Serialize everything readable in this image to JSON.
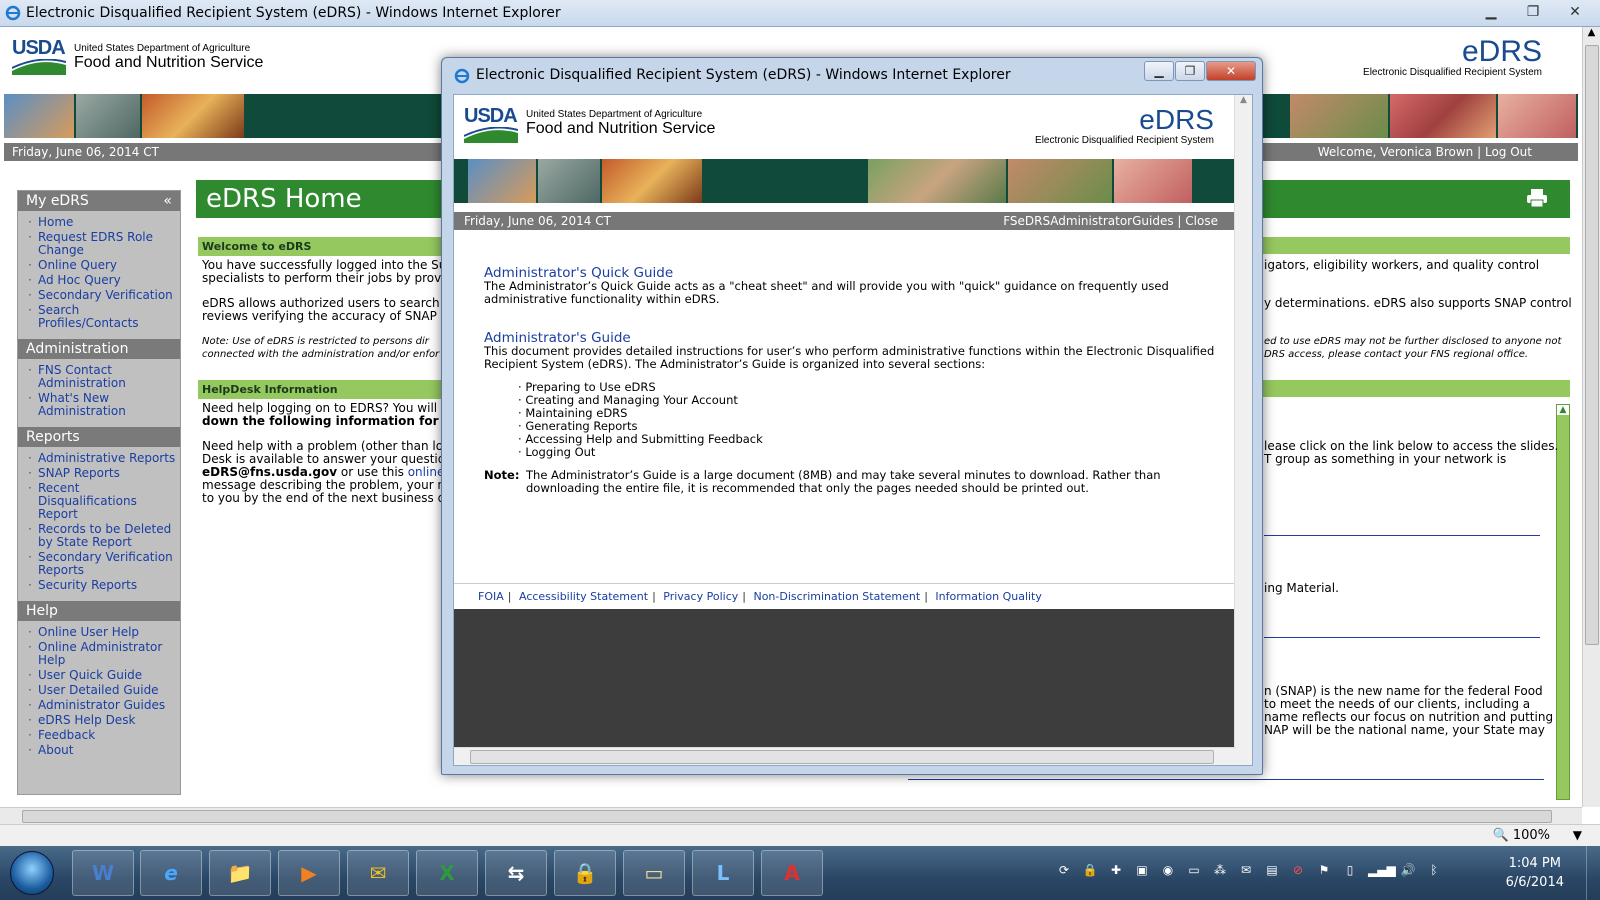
{
  "outer_window": {
    "title": "Electronic Disqualified Recipient System (eDRS) - Windows Internet Explorer",
    "controls": [
      "minimize",
      "maximize",
      "close"
    ]
  },
  "header": {
    "usda_logo": "USDA",
    "department": "United States Department of Agriculture",
    "agency": "Food and Nutrition Service",
    "edrs_logo": "eDRS",
    "edrs_full": "Electronic Disqualified Recipient System"
  },
  "date_bar": {
    "date": "Friday, June 06, 2014 CT",
    "welcome": "Welcome, Veronica Brown",
    "separator": "|",
    "logout": "Log Out"
  },
  "left_nav": {
    "sections": [
      {
        "title": "My eDRS",
        "collapse": "«",
        "items": [
          "Home",
          "Request EDRS Role Change",
          "Online Query",
          "Ad Hoc Query",
          "Secondary Verification",
          "Search Profiles/Contacts"
        ]
      },
      {
        "title": "Administration",
        "items": [
          "FNS Contact Administration",
          "What's New Administration"
        ]
      },
      {
        "title": "Reports",
        "items": [
          "Administrative Reports",
          "SNAP Reports",
          "Recent Disqualifications Report",
          "Records to be Deleted by State Report",
          "Secondary Verification Reports",
          "Security Reports"
        ]
      },
      {
        "title": "Help",
        "items": [
          "Online User Help",
          "Online Administrator Help",
          "User Quick Guide",
          "User Detailed Guide",
          "Administrator Guides",
          "eDRS Help Desk",
          "Feedback",
          "About"
        ]
      }
    ]
  },
  "main": {
    "page_title": "eDRS Home",
    "welcome_heading": "Welcome to eDRS",
    "welcome_p1_left": "You have successfully logged into the Sup",
    "welcome_p1_left2": "specialists to perform their jobs by provid",
    "welcome_p1_right": "igators, eligibility workers, and quality control",
    "welcome_p2_left": "eDRS allows authorized users to search th",
    "welcome_p2_left2": "reviews verifying the accuracy of SNAP el",
    "welcome_p2_right": "y determinations. eDRS also supports SNAP control",
    "note_left": "Note: Use of eDRS is restricted to persons dir",
    "note_left2": "connected with the administration and/or enfor",
    "note_right": "ed to use eDRS may not be further disclosed to anyone not",
    "note_right2": "DRS access, please contact your FNS regional office.",
    "helpdesk_heading": "HelpDesk Information",
    "helpdesk_p1": "Need help logging on to EDRS? You will no",
    "helpdesk_p1b": "down the following information for c",
    "helpdesk_p2": "Need help with a problem (other than logg",
    "helpdesk_p2b": "Desk is available to answer your question",
    "helpdesk_email": "eDRS@fns.usda.gov",
    "helpdesk_p2c": " or use this ",
    "helpdesk_link": "online f",
    "helpdesk_p2d": "message describing the problem, your na",
    "helpdesk_p2e": "to you by the end of the next business da",
    "right_p1": "lease click on the link below to access the slides.",
    "right_p1b": "T group as something in your network is",
    "right_p2": "ing Material.",
    "right_snap1": "n (SNAP) is the new name for the federal Food",
    "right_snap2": " to meet the needs of our clients, including a",
    "right_snap3": "name reflects our focus on nutrition and putting",
    "right_snap4": "NAP will be the national name, your State may"
  },
  "popup": {
    "title": "Electronic Disqualified Recipient System (eDRS) - Windows Internet Explorer",
    "date": "Friday, June 06, 2014 CT",
    "user_link": "FSeDRSAdministratorGuides",
    "separator": "|",
    "close_link": "Close",
    "quick_guide_title": "Administrator's Quick Guide",
    "quick_guide_desc": "The Administrator’s Quick Guide acts as a \"cheat sheet\" and will provide you with \"quick\" guidance on frequently used administrative functionality within eDRS.",
    "guide_title": "Administrator's Guide",
    "guide_desc": "This document provides detailed instructions for user’s who perform administrative functions within the Electronic Disqualified Recipient System (eDRS). The Administrator’s Guide is organized into several sections:",
    "sections": [
      "Preparing to Use eDRS",
      "Creating and Managing Your Account",
      "Maintaining eDRS",
      "Generating Reports",
      "Accessing Help and Submitting Feedback",
      "Logging Out"
    ],
    "note_label": "Note:",
    "note_text": "The Administrator’s Guide is a large document (8MB) and may take several minutes to download. Rather than downloading the entire file, it is recommended that only the pages needed should be printed out.",
    "footer_links": [
      "FOIA",
      "Accessibility Statement",
      "Privacy Policy",
      "Non-Discrimination Statement",
      "Information Quality"
    ]
  },
  "status_bar": {
    "zoom": "100%"
  },
  "taskbar": {
    "apps": [
      "W",
      "e",
      "📁",
      "▶",
      "✉",
      "X",
      "⇆",
      "🔒",
      "▭",
      "L",
      "A"
    ],
    "time": "1:04 PM",
    "date": "6/6/2014"
  },
  "colors": {
    "green_title": "#2f8a2f",
    "green_sub": "#96c860",
    "link_blue": "#1a3ea1",
    "nav_gray": "#c0c0c0",
    "dark_green": "#0f4a3a"
  }
}
